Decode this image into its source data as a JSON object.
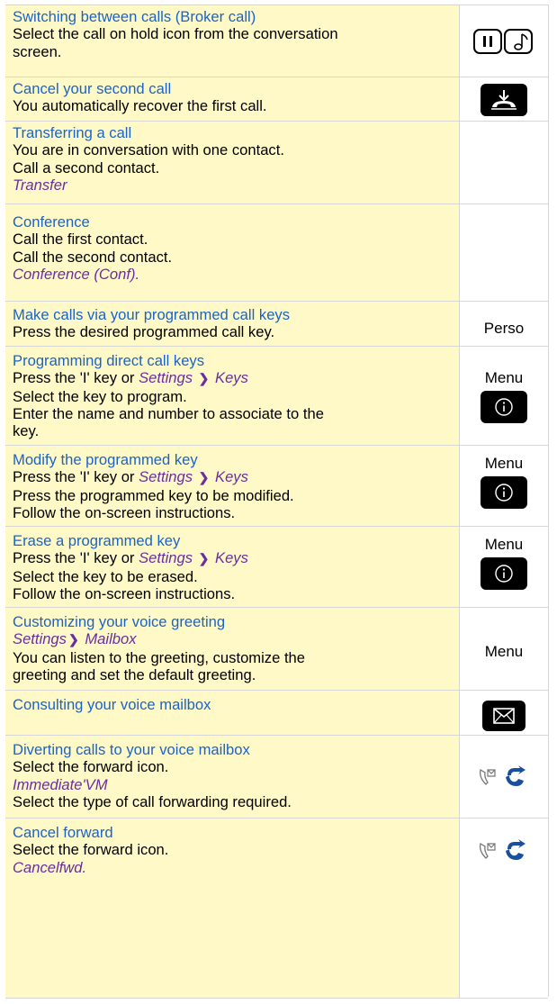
{
  "rows": [
    {
      "title": "Switching between calls (Broker call)",
      "lines": [
        "Select the call on hold icon from the conversation",
        "screen."
      ],
      "icon": "hold-music-icon"
    },
    {
      "title": "Cancel your second call",
      "lines": [
        "You automatically recover the first call."
      ],
      "icon": "hangup-key-icon"
    },
    {
      "title": "Transferring a call",
      "lines": [
        "You are in conversation with one contact.",
        "Call a second contact."
      ],
      "italic": "Transfer"
    },
    {
      "title": "Conference",
      "lines": [
        "Call the first contact.",
        "Call the second contact."
      ],
      "italic": "Conference (Conf)."
    },
    {
      "title": "Make calls via your programmed call keys",
      "lines": [
        "Press the desired programmed call key."
      ],
      "right_label": "Perso"
    },
    {
      "title": "Programming direct call keys",
      "prefix": "Press the 'I' key or ",
      "path_a": "Settings",
      "path_b": "Keys",
      "lines": [
        "Select the key to program.",
        "Enter the name and number to associate to the",
        "key."
      ],
      "right_label": "Menu",
      "icon": "info-key-icon"
    },
    {
      "title": "Modify the programmed key",
      "prefix": "Press the 'I' key or ",
      "path_a": "Settings",
      "path_b": "Keys",
      "lines": [
        "Press the programmed key to be modified.",
        "Follow the on-screen instructions."
      ],
      "right_label": "Menu",
      "icon": "info-key-icon"
    },
    {
      "title": "Erase a programmed key",
      "prefix": "Press the 'I' key or ",
      "path_a": "Settings",
      "path_b": "Keys",
      "lines": [
        "Select the key to be erased.",
        "Follow the on-screen instructions."
      ],
      "right_label": "Menu",
      "icon": "info-key-icon"
    },
    {
      "title": "Customizing your voice greeting",
      "path_a": "Settings",
      "path_b": "Mailbox",
      "lines": [
        "You can listen to the greeting, customize the",
        "greeting and set the default greeting."
      ],
      "right_label": "Menu"
    },
    {
      "title": "Consulting your voice mailbox",
      "icon": "mail-key-icon"
    },
    {
      "title": "Diverting calls to your voice mailbox",
      "lines": [
        "Select the forward icon."
      ],
      "italic": "Immediate'VM",
      "lines2": [
        "Select the type of call forwarding required."
      ],
      "icon": "forward-icon"
    },
    {
      "title": "Cancel forward",
      "lines": [
        "Select the forward icon."
      ],
      "italic": "Cancelfwd.",
      "icon": "forward-icon"
    }
  ]
}
